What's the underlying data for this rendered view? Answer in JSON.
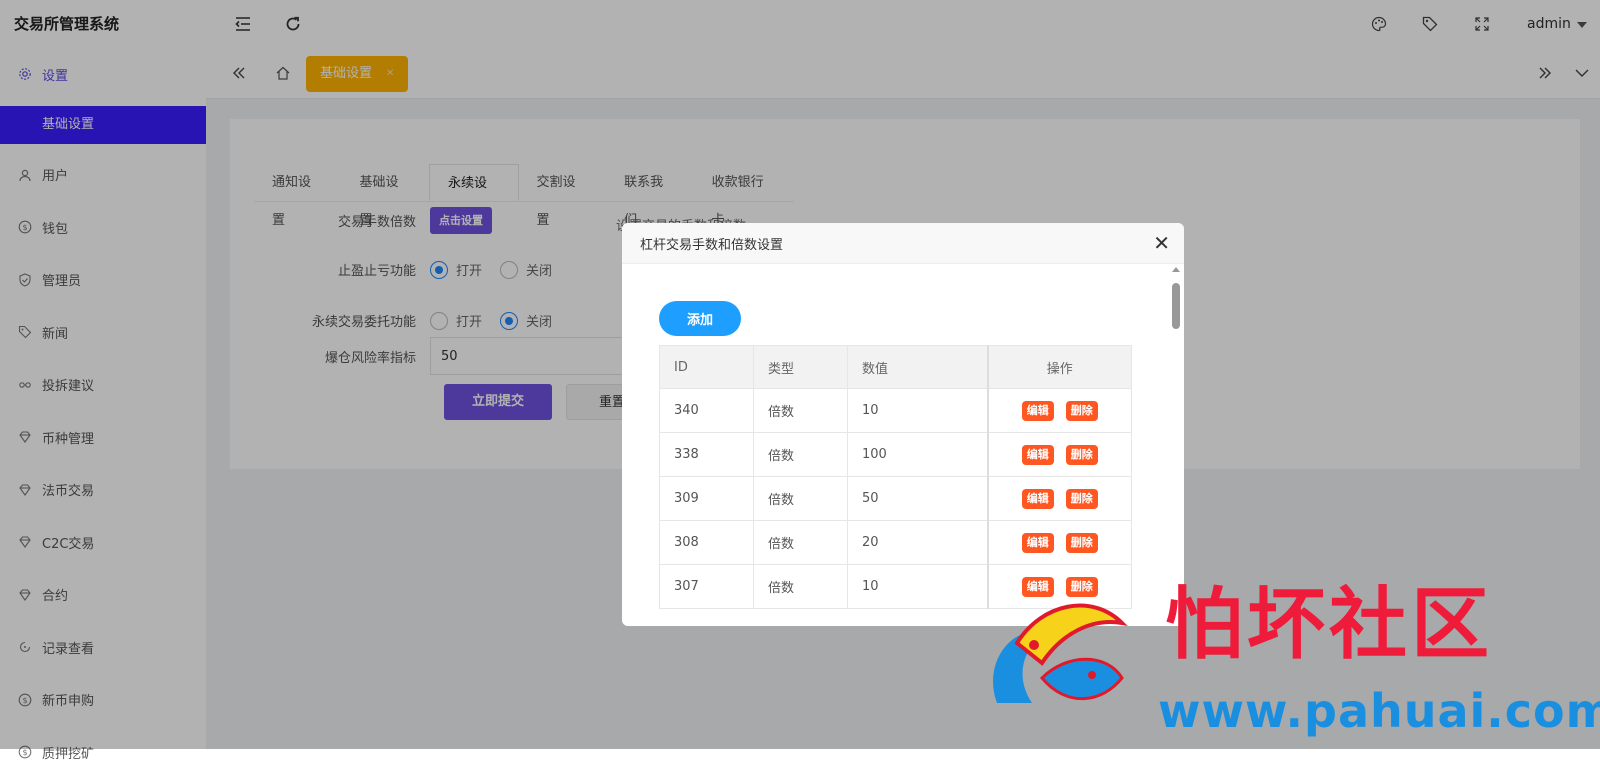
{
  "app": {
    "title": "交易所管理系统",
    "user": "admin"
  },
  "sidebar": {
    "items": [
      {
        "label": "设置",
        "icon": "gear-icon"
      },
      {
        "label": "基础设置"
      },
      {
        "label": "用户",
        "icon": "user-icon"
      },
      {
        "label": "钱包",
        "icon": "dollar-icon"
      },
      {
        "label": "管理员",
        "icon": "shield-icon"
      },
      {
        "label": "新闻",
        "icon": "tag-icon"
      },
      {
        "label": "投拆建议",
        "icon": "link-icon"
      },
      {
        "label": "币种管理",
        "icon": "diamond-icon"
      },
      {
        "label": "法币交易",
        "icon": "diamond-icon"
      },
      {
        "label": "C2C交易",
        "icon": "diamond-icon"
      },
      {
        "label": "合约",
        "icon": "diamond-icon"
      },
      {
        "label": "记录查看",
        "icon": "refresh-icon"
      },
      {
        "label": "新币申购",
        "icon": "dollar-icon"
      },
      {
        "label": "质押挖矿",
        "icon": "dollar-icon"
      }
    ]
  },
  "pagetabs": {
    "active": "基础设置"
  },
  "settings": {
    "tabs": [
      "通知设置",
      "基础设置",
      "永续设置",
      "交割设置",
      "联系我们",
      "收款银行卡"
    ],
    "fee_label": "交易手数倍数",
    "fee_button": "点击设置",
    "fee_hint": "设置交易的手数和倍数",
    "stop_label": "止盈止亏功能",
    "entrust_label": "永续交易委托功能",
    "open": "打开",
    "close": "关闭",
    "risk_label": "爆仓风险率指标",
    "risk_value": "50",
    "submit": "立即提交",
    "reset": "重置"
  },
  "dialog": {
    "title": "杠杆交易手数和倍数设置",
    "add": "添加",
    "headers": [
      "ID",
      "类型",
      "数值",
      "操作"
    ],
    "edit": "编辑",
    "delete": "删除",
    "rows": [
      [
        "340",
        "倍数",
        "10"
      ],
      [
        "338",
        "倍数",
        "100"
      ],
      [
        "309",
        "倍数",
        "50"
      ],
      [
        "308",
        "倍数",
        "20"
      ],
      [
        "307",
        "倍数",
        "10"
      ]
    ]
  },
  "watermark": {
    "text": "怕坏社区",
    "url": "www.pahuai.com"
  }
}
